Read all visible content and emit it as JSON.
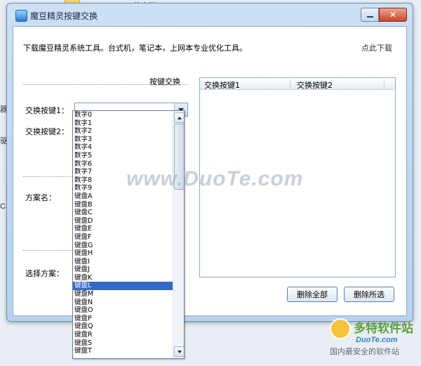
{
  "background": {
    "doc_title": "dondon 的文档",
    "left_fragments": [
      "器",
      "驱动",
      "Cam"
    ]
  },
  "watermark": {
    "main": "www.DuoTe.com",
    "logo_cn": "多特软件站",
    "logo_en": "DuoTe.com",
    "tagline": "国内最安全的软件站"
  },
  "window": {
    "title": "魔豆精灵按键交换",
    "promo_text": "下载魔豆精灵系统工具。台式机，笔记本，上网本专业优化工具。",
    "download_link": "点此下载"
  },
  "form": {
    "section_title": "按键交换",
    "key1_label": "交换按键1：",
    "key2_label": "交换按键2：",
    "scheme_name_label": "方案名：",
    "choose_scheme_label": "选择方案：",
    "key1_value": ""
  },
  "listview": {
    "columns": [
      "交换按键1",
      "交换按键2"
    ]
  },
  "buttons": {
    "delete_all": "删除全部",
    "delete_selected": "删除所选"
  },
  "dropdown": {
    "items": [
      "数字0",
      "数字1",
      "数字2",
      "数字3",
      "数字4",
      "数字5",
      "数字6",
      "数字7",
      "数字8",
      "数字9",
      "键盘A",
      "键盘B",
      "键盘C",
      "键盘D",
      "键盘E",
      "键盘F",
      "键盘G",
      "键盘H",
      "键盘I",
      "键盘J",
      "键盘K",
      "键盘L",
      "键盘M",
      "键盘N",
      "键盘O",
      "键盘P",
      "键盘Q",
      "键盘R",
      "键盘S",
      "键盘T"
    ],
    "selected": "键盘L"
  },
  "colors": {
    "selection": "#3369c9",
    "window_frame": "#b7d3ee"
  }
}
